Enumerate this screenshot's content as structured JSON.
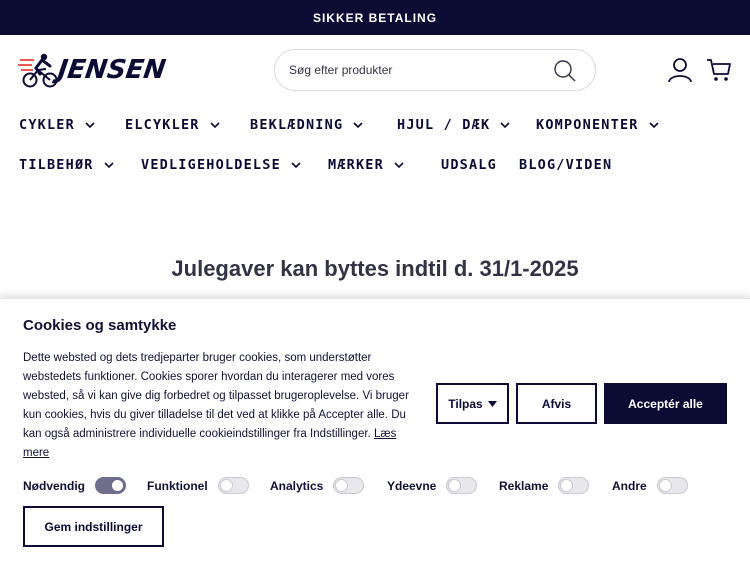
{
  "topbar": {
    "text": "SIKKER BETALING"
  },
  "header": {
    "logo_text": "JENSEN",
    "search_placeholder": "Søg efter produkter"
  },
  "nav": {
    "items": [
      {
        "label": "CYKLER",
        "has_dropdown": true
      },
      {
        "label": "ELCYKLER",
        "has_dropdown": true
      },
      {
        "label": "BEKLÆDNING",
        "has_dropdown": true
      },
      {
        "label": "HJUL / DÆK",
        "has_dropdown": true
      },
      {
        "label": "KOMPONENTER",
        "has_dropdown": true
      },
      {
        "label": "TILBEHØR",
        "has_dropdown": true
      },
      {
        "label": "VEDLIGEHOLDELSE",
        "has_dropdown": true
      },
      {
        "label": "MÆRKER",
        "has_dropdown": true
      },
      {
        "label": "UDSALG",
        "has_dropdown": false
      },
      {
        "label": "BLOG/VIDEN",
        "has_dropdown": false
      }
    ]
  },
  "main": {
    "headline": "Julegaver kan byttes indtil d. 31/1-2025"
  },
  "cookie": {
    "title": "Cookies og samtykke",
    "body": "Dette websted og dets tredjeparter bruger cookies, som understøtter webstedets funktioner. Cookies sporer hvordan du interagerer med vores websted, så vi kan give dig forbedret og tilpasset brugeroplevelse. Vi bruger kun cookies, hvis du giver tilladelse til det ved at klikke på Accepter alle. Du kan også administrere individuelle cookieindstillinger fra Indstillinger.",
    "read_more": "Læs mere",
    "customize_label": "Tilpas",
    "reject_label": "Afvis",
    "accept_label": "Acceptér alle",
    "save_label": "Gem indstillinger",
    "categories": [
      {
        "label": "Nødvendig",
        "enabled": true
      },
      {
        "label": "Funktionel",
        "enabled": false
      },
      {
        "label": "Analytics",
        "enabled": false
      },
      {
        "label": "Ydeevne",
        "enabled": false
      },
      {
        "label": "Reklame",
        "enabled": false
      },
      {
        "label": "Andre",
        "enabled": false
      }
    ]
  },
  "colors": {
    "brand_navy": "#0c0b33",
    "toggle_on": "#6e6e8c"
  },
  "icons": [
    "search-icon",
    "account-icon",
    "cart-icon",
    "chevron-down-icon",
    "caret-down-icon"
  ]
}
